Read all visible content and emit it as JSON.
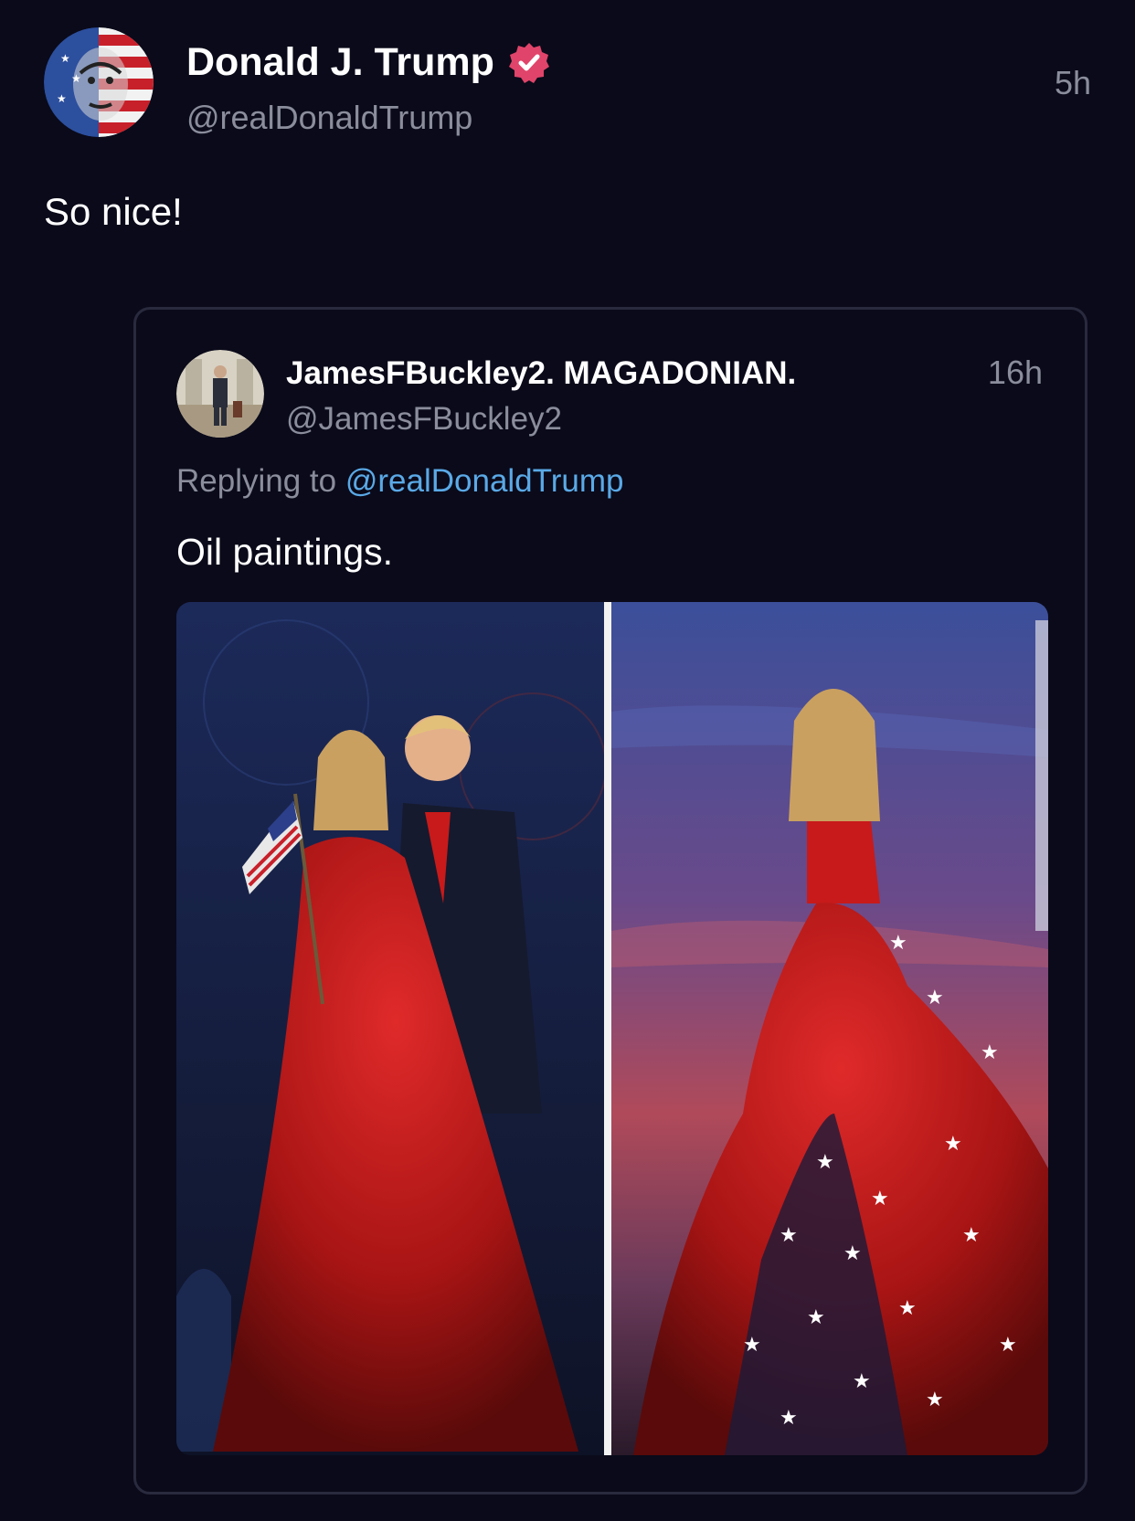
{
  "post": {
    "display_name": "Donald J. Trump",
    "handle": "@realDonaldTrump",
    "timestamp": "5h",
    "text": "So nice!",
    "avatar_icon": "flag-portrait-avatar",
    "verified_icon": "verified-badge-icon"
  },
  "quote": {
    "display_name": "JamesFBuckley2. MAGADONIAN.",
    "handle": "@JamesFBuckley2",
    "timestamp": "16h",
    "replying_prefix": "Replying to",
    "replying_mention": "@realDonaldTrump",
    "text": "Oil paintings.",
    "media_description_icon": "oil-paintings-image"
  },
  "colors": {
    "background": "#0a0a1a",
    "secondary_text": "#8b8d9c",
    "mention": "#5aa9e6",
    "verified_badge": "#e0446a",
    "card_border": "#2a2a3e"
  }
}
